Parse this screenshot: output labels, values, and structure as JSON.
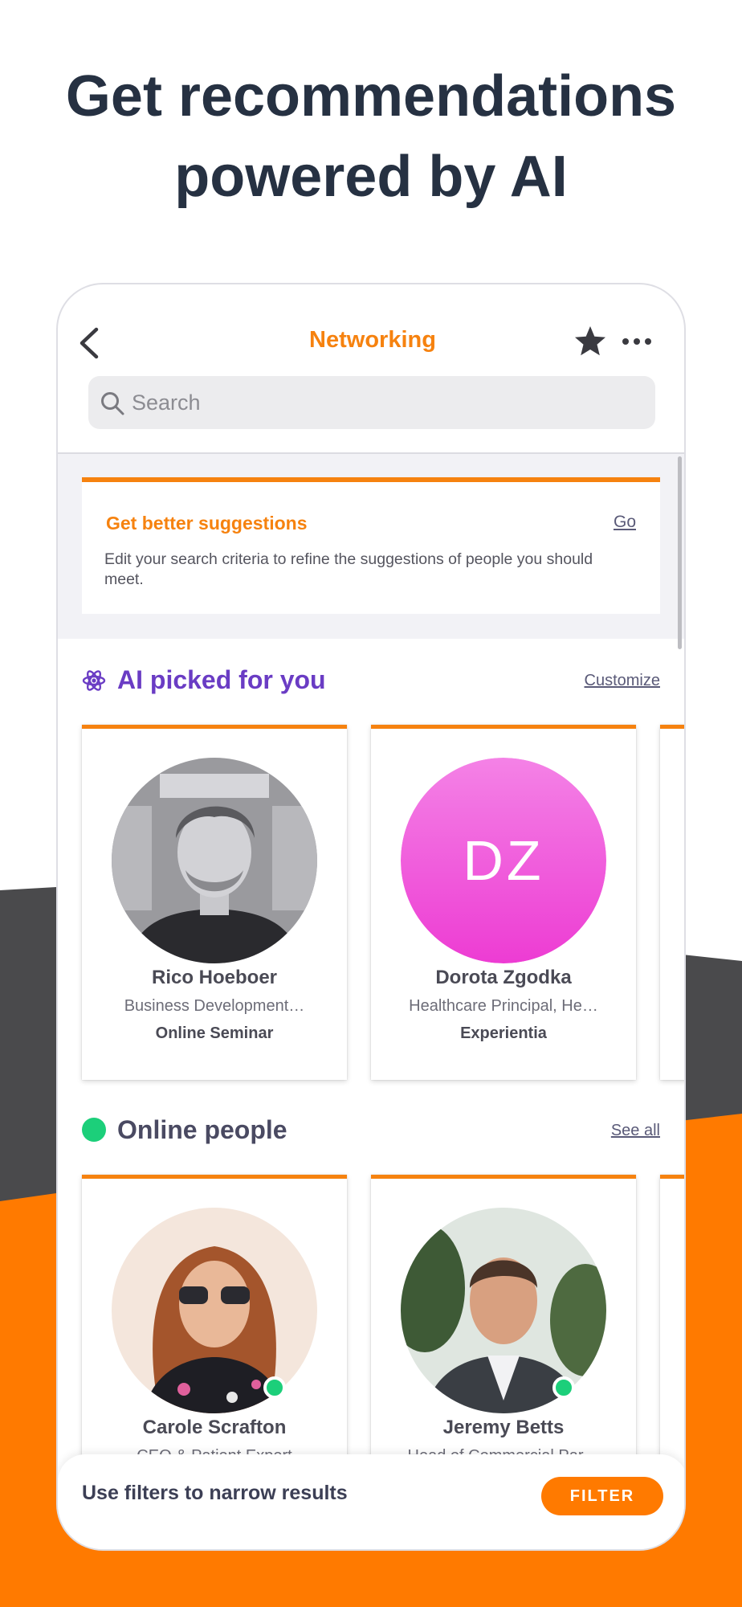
{
  "headline": {
    "line1": "Get recommendations",
    "line2": "powered by AI"
  },
  "nav": {
    "title": "Networking",
    "back_icon": "chevron-left-icon",
    "star_icon": "star-icon",
    "more_icon": "more-dots-icon"
  },
  "search": {
    "placeholder": "Search",
    "icon": "search-icon"
  },
  "banner": {
    "title": "Get better suggestions",
    "action": "Go",
    "description": "Edit your search criteria to refine the suggestions of people you should meet."
  },
  "ai_section": {
    "title": "AI picked for you",
    "link": "Customize",
    "icon": "atom-icon",
    "cards": [
      {
        "name": "Rico Hoeboer",
        "role": "Business Development…",
        "org": "Online Seminar"
      },
      {
        "name": "Dorota Zgodka",
        "initials": "DZ",
        "role": "Healthcare Principal, He…",
        "org": "Experientia"
      }
    ]
  },
  "online_section": {
    "title": "Online people",
    "link": "See all",
    "cards": [
      {
        "name": "Carole Scrafton",
        "role": "CEO & Patient Expert",
        "online": true
      },
      {
        "name": "Jeremy Betts",
        "role": "Head of Commercial Par…",
        "online": true
      }
    ]
  },
  "filter_bar": {
    "text": "Use filters to narrow results",
    "button": "FILTER"
  },
  "colors": {
    "accent": "#f6820f",
    "ai_purple": "#6a3cc4",
    "online_green": "#1ccf7a",
    "headline": "#263142"
  }
}
